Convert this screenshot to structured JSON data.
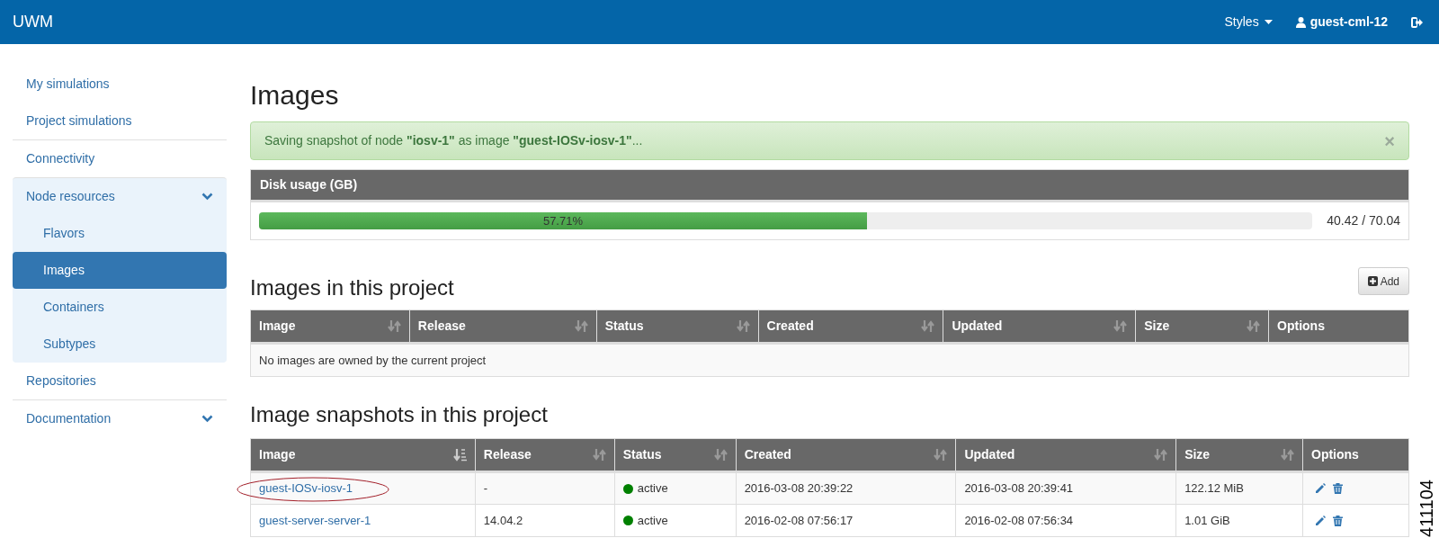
{
  "navbar": {
    "brand": "UWM",
    "styles_menu": "Styles",
    "user": "guest-cml-12"
  },
  "sidebar": {
    "items": [
      {
        "label": "My simulations",
        "selected": false,
        "kind": "link"
      },
      {
        "label": "Project simulations",
        "selected": false,
        "kind": "link"
      },
      {
        "label": "Connectivity",
        "selected": false,
        "kind": "link"
      },
      {
        "label": "Node resources",
        "selected": false,
        "kind": "group",
        "children": [
          {
            "label": "Flavors",
            "selected": false
          },
          {
            "label": "Images",
            "selected": true
          },
          {
            "label": "Containers",
            "selected": false
          },
          {
            "label": "Subtypes",
            "selected": false
          }
        ]
      },
      {
        "label": "Repositories",
        "selected": false,
        "kind": "link"
      },
      {
        "label": "Documentation",
        "selected": false,
        "kind": "group"
      }
    ]
  },
  "page_title": "Images",
  "alert": {
    "message": "Saving snapshot of node **\"iosv-1\"** as image **\"guest-IOSv-iosv-1\"**...",
    "close": "×"
  },
  "disk_usage": {
    "title": "Disk usage (GB)",
    "level": 0.5771,
    "percent": "57.71%",
    "reading": "40.42 / 70.04"
  },
  "images_section": {
    "title": "Images in this project",
    "add_button": "Add",
    "columns": [
      {
        "label": "Image",
        "sortable": true,
        "sorted": false
      },
      {
        "label": "Release",
        "sortable": true,
        "sorted": false
      },
      {
        "label": "Status",
        "sortable": true,
        "sorted": false
      },
      {
        "label": "Created",
        "sortable": true,
        "sorted": false
      },
      {
        "label": "Updated",
        "sortable": true,
        "sorted": false
      },
      {
        "label": "Size",
        "sortable": true,
        "sorted": false
      },
      {
        "label": "Options",
        "sortable": false
      }
    ],
    "empty_message": "No images are owned by the current project"
  },
  "snapshots_section": {
    "title": "Image snapshots in this project",
    "columns": [
      {
        "label": "Image",
        "sortable": true,
        "sorted": true
      },
      {
        "label": "Release",
        "sortable": true,
        "sorted": false
      },
      {
        "label": "Status",
        "sortable": true,
        "sorted": false
      },
      {
        "label": "Created",
        "sortable": true,
        "sorted": false
      },
      {
        "label": "Updated",
        "sortable": true,
        "sorted": false
      },
      {
        "label": "Size",
        "sortable": true,
        "sorted": false
      },
      {
        "label": "Options",
        "sortable": false
      }
    ],
    "rows": [
      {
        "image": "guest-IOSv-iosv-1",
        "circled": true,
        "release": "-",
        "status": "active",
        "color": "#008000",
        "created": "2016-03-08 20:39:22",
        "updated": "2016-03-08 20:39:41",
        "size": "122.12 MiB"
      },
      {
        "image": "guest-server-server-1",
        "circled": false,
        "release": "14.04.2",
        "status": "active",
        "color": "#008000",
        "created": "2016-02-08 07:56:17",
        "updated": "2016-02-08 07:56:34",
        "size": "1.01 GiB"
      }
    ]
  },
  "figure_number": "411104"
}
